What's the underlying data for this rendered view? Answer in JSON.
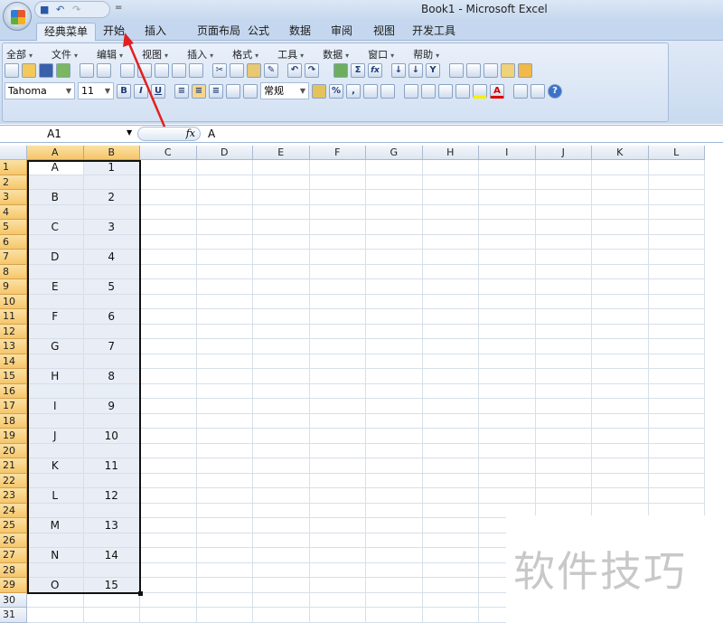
{
  "window": {
    "title": "Book1 - Microsoft Excel"
  },
  "qat": {
    "icons": [
      "save-icon",
      "undo-icon",
      "redo-icon"
    ],
    "more": "="
  },
  "tabs": [
    {
      "label": "经典菜单",
      "active": true
    },
    {
      "label": "开始"
    },
    {
      "label": "插入"
    },
    {
      "label": "页面布局"
    },
    {
      "label": "公式"
    },
    {
      "label": "数据"
    },
    {
      "label": "审阅"
    },
    {
      "label": "视图"
    },
    {
      "label": "开发工具"
    }
  ],
  "menubar": [
    "全部",
    "文件",
    "编辑",
    "视图",
    "插入",
    "格式",
    "工具",
    "数据",
    "窗口",
    "帮助"
  ],
  "toolbar": {
    "font": "Tahoma",
    "size": "11",
    "bold": "B",
    "italic": "I",
    "underline": "U",
    "number_format": "常规",
    "percent": "%",
    "comma": ",",
    "sum": "Σ",
    "fx": "fx"
  },
  "formula_bar": {
    "name_box": "A1",
    "fx_label": "fx",
    "value": "A"
  },
  "grid": {
    "columns": [
      "A",
      "B",
      "C",
      "D",
      "E",
      "F",
      "G",
      "H",
      "I",
      "J",
      "K",
      "L"
    ],
    "row_count": 31,
    "selected_columns": [
      "A",
      "B"
    ],
    "selected_rows_to": 29,
    "cells": {
      "1": [
        "A",
        "1"
      ],
      "3": [
        "B",
        "2"
      ],
      "5": [
        "C",
        "3"
      ],
      "7": [
        "D",
        "4"
      ],
      "9": [
        "E",
        "5"
      ],
      "11": [
        "F",
        "6"
      ],
      "13": [
        "G",
        "7"
      ],
      "15": [
        "H",
        "8"
      ],
      "17": [
        "I",
        "9"
      ],
      "19": [
        "J",
        "10"
      ],
      "21": [
        "K",
        "11"
      ],
      "23": [
        "L",
        "12"
      ],
      "25": [
        "M",
        "13"
      ],
      "27": [
        "N",
        "14"
      ],
      "29": [
        "O",
        "15"
      ]
    }
  },
  "annotation": {
    "color": "#e02020"
  },
  "watermark": "软件技巧"
}
